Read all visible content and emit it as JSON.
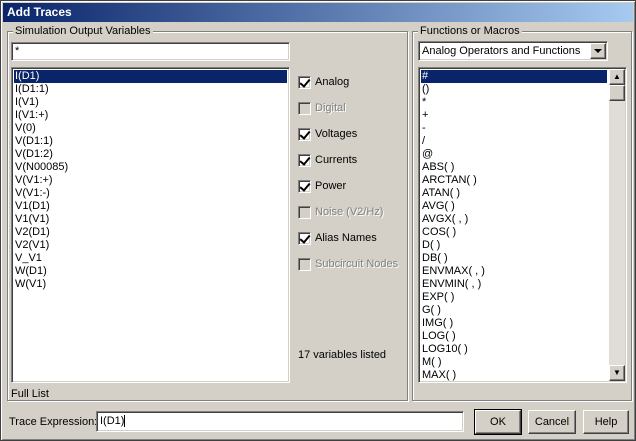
{
  "window": {
    "title": "Add Traces"
  },
  "sim_vars": {
    "group_label": "Simulation Output Variables",
    "filter_value": "*",
    "items": [
      "I(D1)",
      "I(D1:1)",
      "I(V1)",
      "I(V1:+)",
      "V(0)",
      "V(D1:1)",
      "V(D1:2)",
      "V(N00085)",
      "V(V1:+)",
      "V(V1:-)",
      "V1(D1)",
      "V1(V1)",
      "V2(D1)",
      "V2(V1)",
      "V_V1",
      "W(D1)",
      "W(V1)"
    ],
    "selected_index": 0,
    "footer": "Full List"
  },
  "options": [
    {
      "label": "Analog",
      "checked": true,
      "enabled": true
    },
    {
      "label": "Digital",
      "checked": false,
      "enabled": false
    },
    {
      "label": "Voltages",
      "checked": true,
      "enabled": true
    },
    {
      "label": "Currents",
      "checked": true,
      "enabled": true
    },
    {
      "label": "Power",
      "checked": true,
      "enabled": true
    },
    {
      "label": "Noise (V2/Hz)",
      "checked": false,
      "enabled": false
    },
    {
      "label": "Alias Names",
      "checked": true,
      "enabled": true
    },
    {
      "label": "Subcircuit Nodes",
      "checked": false,
      "enabled": false
    }
  ],
  "count_text": "17 variables listed",
  "functions": {
    "group_label": "Functions or Macros",
    "dropdown_value": "Analog Operators and Functions",
    "items": [
      "#",
      "()",
      "*",
      "+",
      "-",
      "/",
      "@",
      "ABS( )",
      "ARCTAN( )",
      "ATAN( )",
      "AVG( )",
      "AVGX( , )",
      "COS( )",
      "D( )",
      "DB( )",
      "ENVMAX( , )",
      "ENVMIN( , )",
      "EXP( )",
      "G( )",
      "IMG( )",
      "LOG( )",
      "LOG10( )",
      "M( )",
      "MAX( )"
    ],
    "selected_index": 0
  },
  "trace": {
    "label": "Trace Expression:",
    "value": "I(D1)"
  },
  "buttons": {
    "ok": "OK",
    "cancel": "Cancel",
    "help": "Help"
  }
}
